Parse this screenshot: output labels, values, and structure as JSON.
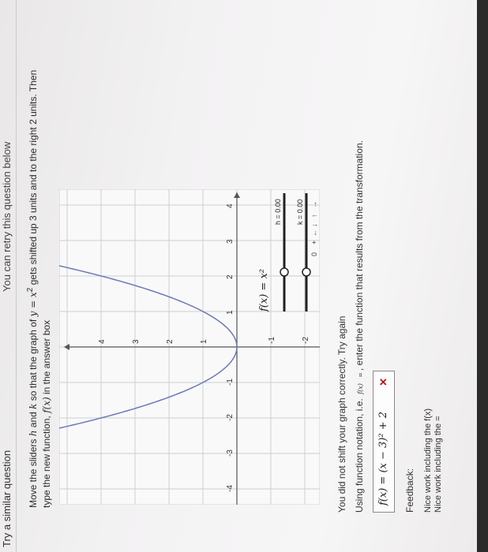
{
  "tabs": {
    "active_label": "Try a similar question",
    "retry_label": "You can retry this question below"
  },
  "instructions": {
    "line1_a": "Move the sliders ",
    "h": "h",
    "line1_b": " and ",
    "k": "k",
    "line1_c": " so that the graph of ",
    "eq": "y = x",
    "exp": "2",
    "line1_d": " gets shifted up 3 units and to the right 2 units. Then",
    "line2_a": "type the new function, ",
    "fx": "f(x)",
    "line2_b": " in the answer box"
  },
  "graph": {
    "x_ticks": [
      "-4",
      "-3",
      "-2",
      "-1",
      "1",
      "2",
      "3",
      "4"
    ],
    "y_ticks": [
      "-2",
      "-1",
      "1",
      "2",
      "3",
      "4"
    ],
    "func_label": "f(x) = x²",
    "slider_h_label": "h = 0.00",
    "slider_k_label": "k = 0.00",
    "zoom_zero": "0",
    "zoom_plus": "+",
    "arrow_left": "←",
    "arrow_down": "↓",
    "arrow_up": "↑",
    "arrow_right": "→",
    "curve_color": "#6b79b8"
  },
  "result": {
    "message": "You did not shift your graph correctly. Try again",
    "notation_a": "Using function notation, i.e.",
    "notation_fx": "f(x)",
    "notation_eq": "=",
    "notation_b": ", enter the function that results from the transformation."
  },
  "answer": {
    "value": "f(x) = (x − 3)² + 2",
    "status_icon": "✕"
  },
  "feedback": {
    "title": "Feedback:",
    "line1": "Nice work including the f(x)",
    "line2": "Nice work including the ="
  }
}
